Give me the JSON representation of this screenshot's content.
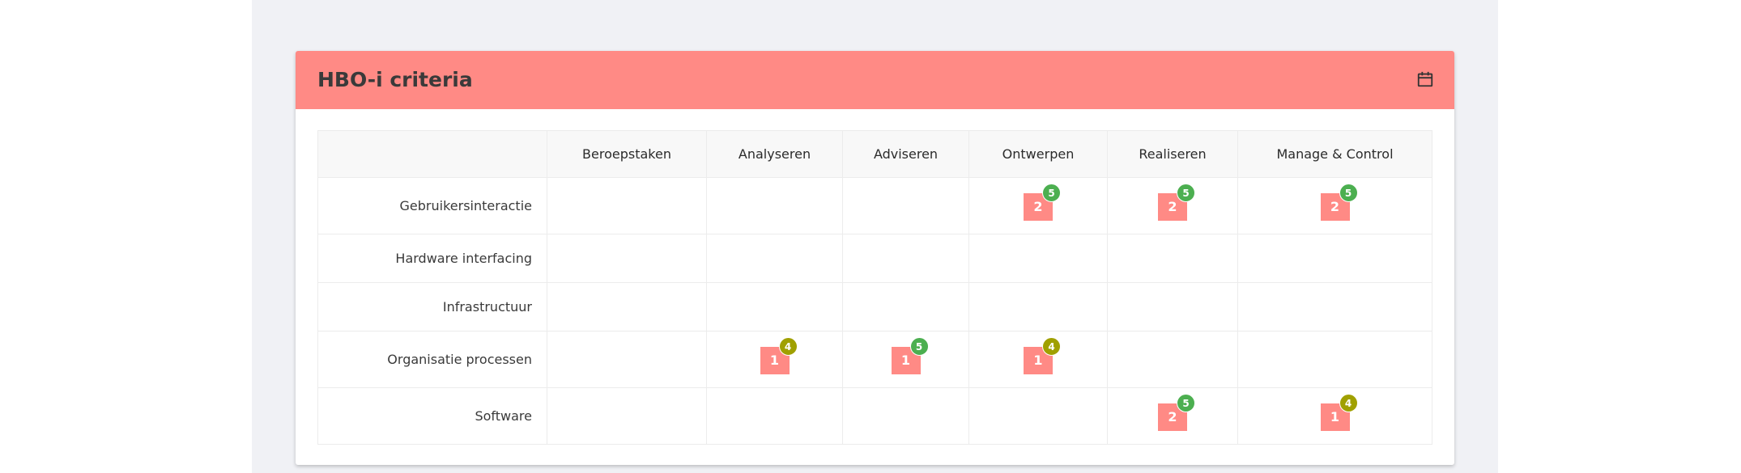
{
  "card": {
    "title": "HBO-i criteria"
  },
  "icons": {
    "header": "calendar-icon"
  },
  "colors": {
    "header": "#ff8a85",
    "badge_high": "#4caf50",
    "badge_mid": "#a0a000",
    "background": "#f0f1f5"
  },
  "table": {
    "columns": [
      "",
      "Beroepstaken",
      "Analyseren",
      "Adviseren",
      "Ontwerpen",
      "Realiseren",
      "Manage & Control"
    ],
    "rows": [
      {
        "label": "Gebruikersinteractie",
        "cells": [
          null,
          null,
          null,
          {
            "level": "2",
            "count": "5",
            "tone": "high"
          },
          {
            "level": "2",
            "count": "5",
            "tone": "high"
          },
          {
            "level": "2",
            "count": "5",
            "tone": "high"
          }
        ]
      },
      {
        "label": "Hardware interfacing",
        "cells": [
          null,
          null,
          null,
          null,
          null,
          null
        ]
      },
      {
        "label": "Infrastructuur",
        "cells": [
          null,
          null,
          null,
          null,
          null,
          null
        ]
      },
      {
        "label": "Organisatie processen",
        "cells": [
          null,
          {
            "level": "1",
            "count": "4",
            "tone": "mid"
          },
          {
            "level": "1",
            "count": "5",
            "tone": "high"
          },
          {
            "level": "1",
            "count": "4",
            "tone": "mid"
          },
          null,
          null
        ]
      },
      {
        "label": "Software",
        "cells": [
          null,
          null,
          null,
          null,
          {
            "level": "2",
            "count": "5",
            "tone": "high"
          },
          {
            "level": "1",
            "count": "4",
            "tone": "mid"
          }
        ]
      }
    ]
  }
}
